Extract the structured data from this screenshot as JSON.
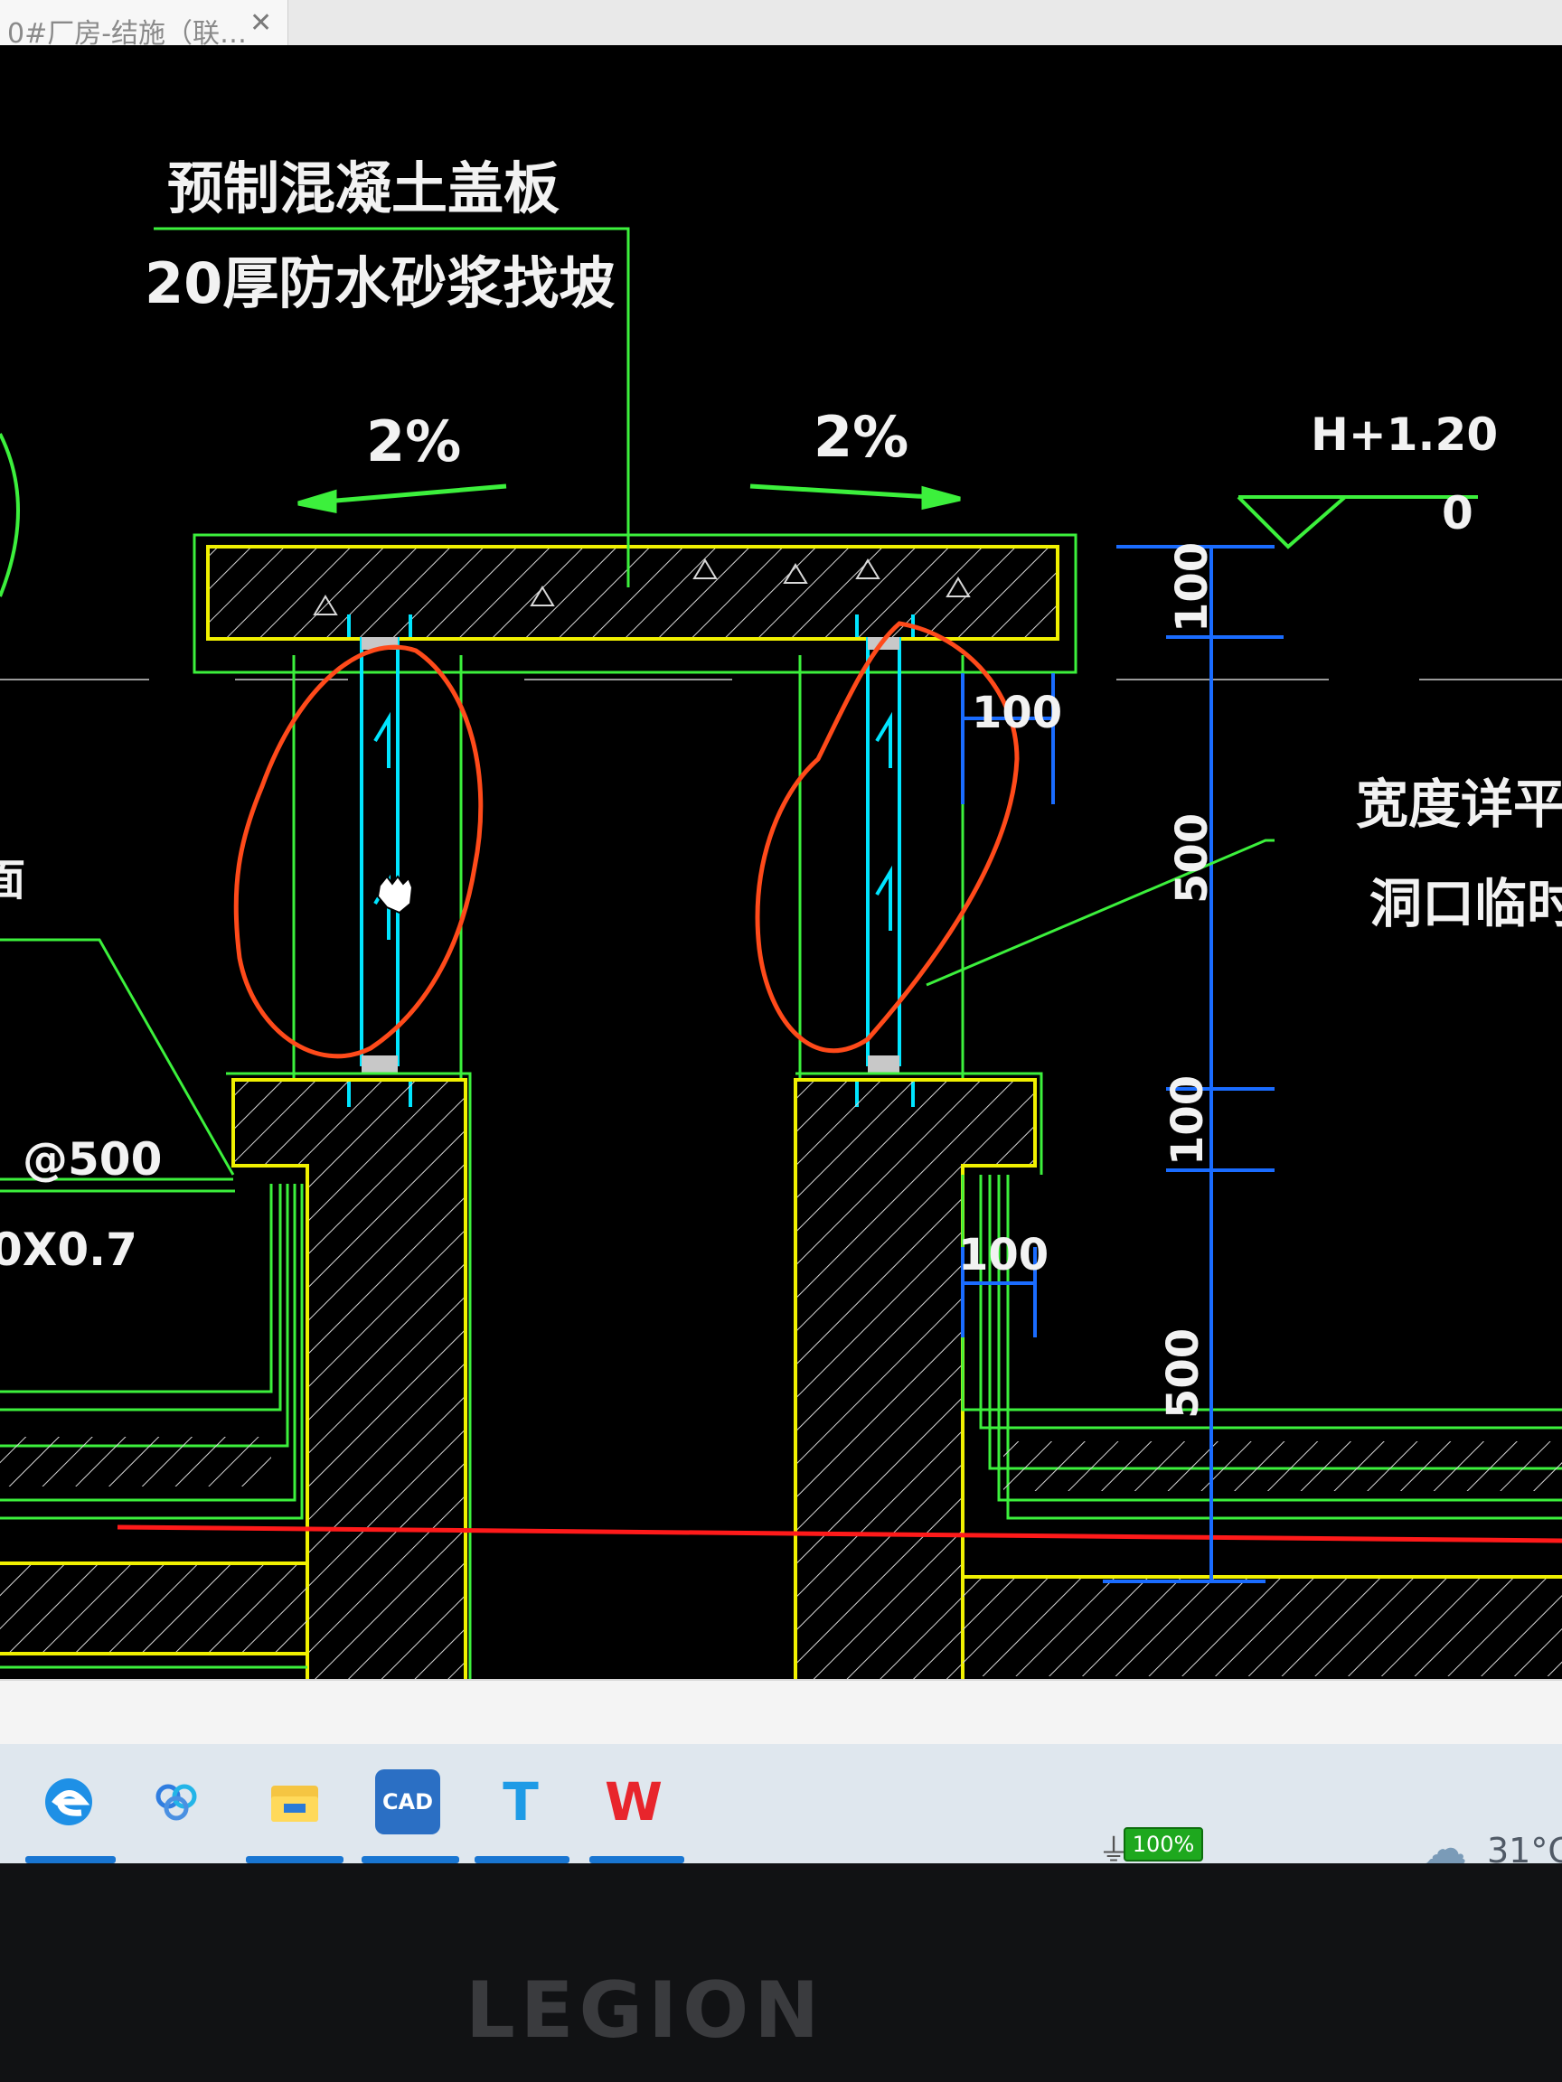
{
  "window": {
    "tab_title": "0#厂房-结施（联…",
    "tab_close": "✕"
  },
  "drawing": {
    "note_line1": "预制混凝土盖板",
    "note_line2": "20厚防水砂浆找坡",
    "slope_left": "2%",
    "slope_right": "2%",
    "elevation": "H+1.20",
    "elevation_zero": "0",
    "dim_100_top": "100",
    "dim_500_mid": "500",
    "dim_100_mid": "100",
    "dim_500_low": "500",
    "dim_100_inner_top": "100",
    "dim_100_inner_low": "100",
    "right_note_line1": "宽度详平面图",
    "right_note_line2": "洞口临时封堵",
    "left_note_frag1": "@500",
    "left_note_frag2": "0X0.7",
    "left_note_frag0": "面"
  },
  "taskbar": {
    "icons": [
      "edge-icon",
      "baidu-netdisk-icon",
      "file-explorer-icon",
      "cad-icon",
      "text-editor-icon",
      "wps-icon"
    ],
    "cad_label": "CAD",
    "battery": "100%",
    "temperature": "31°C"
  },
  "bezel": {
    "brand": "LEGION"
  },
  "colors": {
    "cad_bg": "#000000",
    "green_line": "#3cf03c",
    "yellow_line": "#f0f000",
    "cyan_line": "#00e5ff",
    "blue_dim": "#1a6cff",
    "red_line": "#ff1a1a",
    "annotation_red": "#ff4a1a"
  }
}
